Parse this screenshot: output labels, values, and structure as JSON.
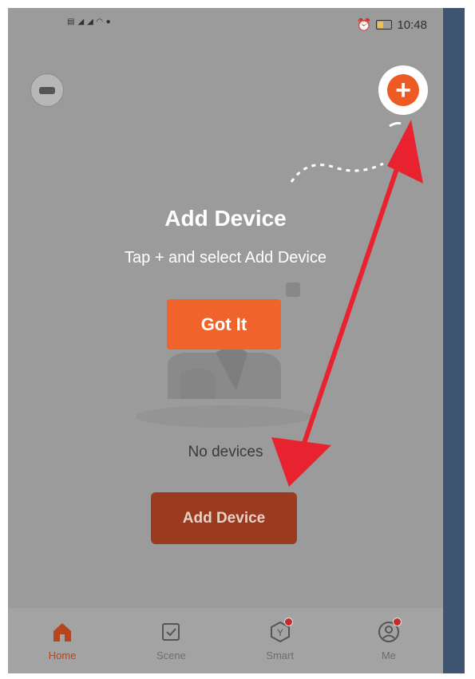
{
  "status_bar": {
    "left_icons": [
      "sim-icon",
      "signal-icon",
      "signal-icon",
      "wifi-icon",
      "chat-icon"
    ],
    "time": "10:48",
    "right_icons": [
      "alarm-icon",
      "battery-icon"
    ]
  },
  "header": {
    "avatar_icon": "avatar-icon",
    "add_icon": "plus-icon"
  },
  "onboarding": {
    "title": "Add Device",
    "subtitle": "Tap + and select Add Device",
    "got_it_label": "Got It"
  },
  "main": {
    "empty_text": "No devices",
    "add_device_label": "Add Device"
  },
  "bottom_nav": {
    "items": [
      {
        "label": "Home",
        "icon": "home-icon",
        "active": true
      },
      {
        "label": "Scene",
        "icon": "scene-icon",
        "active": false
      },
      {
        "label": "Smart",
        "icon": "smart-icon",
        "active": false,
        "badge": true
      },
      {
        "label": "Me",
        "icon": "profile-icon",
        "active": false,
        "badge": true
      }
    ]
  },
  "colors": {
    "accent": "#f0632a",
    "add_device_button": "#9a3a1e",
    "overlay_gray": "#9b9b9b",
    "annotation_arrow": "#e8232f",
    "side_strip": "#3e5572"
  }
}
